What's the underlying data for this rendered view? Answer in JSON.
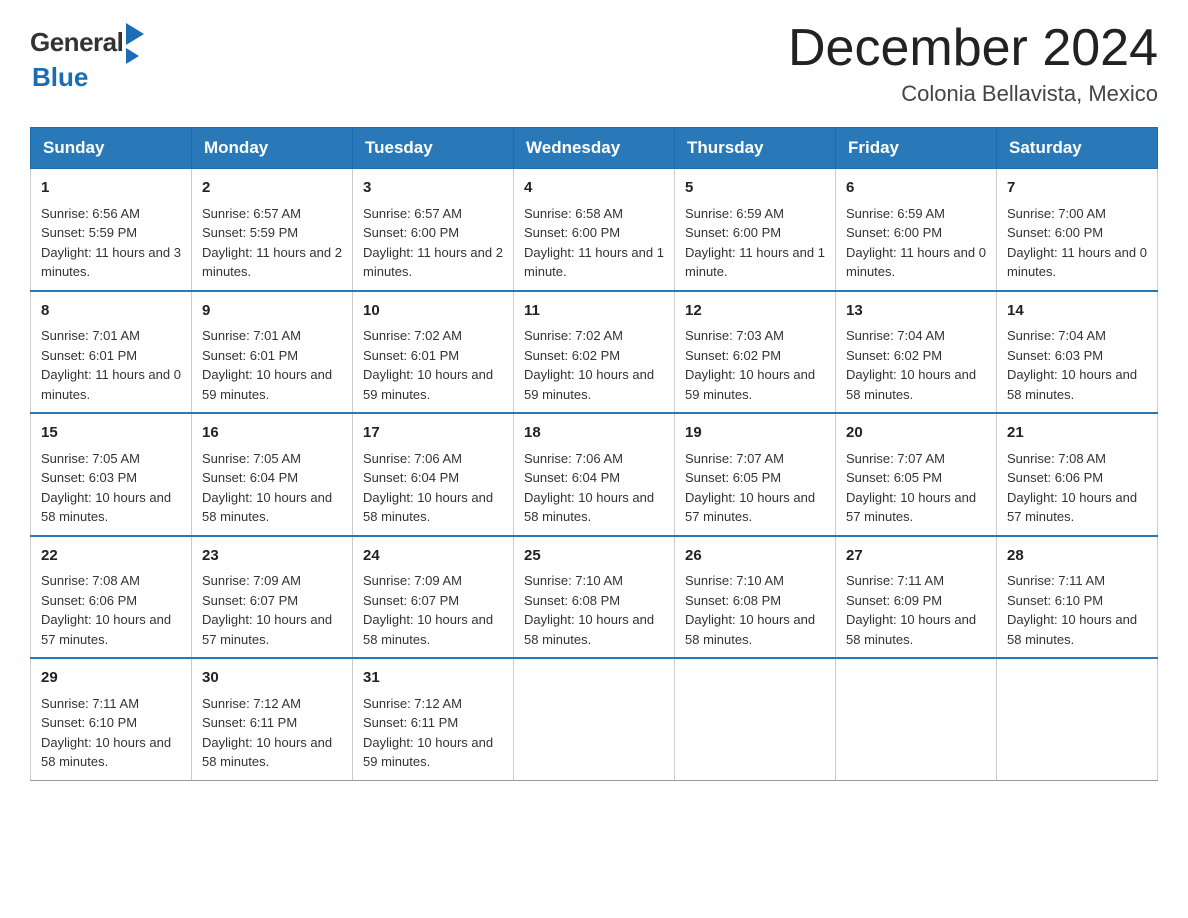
{
  "header": {
    "logo_general": "General",
    "logo_blue": "Blue",
    "month_title": "December 2024",
    "location": "Colonia Bellavista, Mexico"
  },
  "days_of_week": [
    "Sunday",
    "Monday",
    "Tuesday",
    "Wednesday",
    "Thursday",
    "Friday",
    "Saturday"
  ],
  "weeks": [
    [
      {
        "day": "1",
        "sunrise": "Sunrise: 6:56 AM",
        "sunset": "Sunset: 5:59 PM",
        "daylight": "Daylight: 11 hours and 3 minutes."
      },
      {
        "day": "2",
        "sunrise": "Sunrise: 6:57 AM",
        "sunset": "Sunset: 5:59 PM",
        "daylight": "Daylight: 11 hours and 2 minutes."
      },
      {
        "day": "3",
        "sunrise": "Sunrise: 6:57 AM",
        "sunset": "Sunset: 6:00 PM",
        "daylight": "Daylight: 11 hours and 2 minutes."
      },
      {
        "day": "4",
        "sunrise": "Sunrise: 6:58 AM",
        "sunset": "Sunset: 6:00 PM",
        "daylight": "Daylight: 11 hours and 1 minute."
      },
      {
        "day": "5",
        "sunrise": "Sunrise: 6:59 AM",
        "sunset": "Sunset: 6:00 PM",
        "daylight": "Daylight: 11 hours and 1 minute."
      },
      {
        "day": "6",
        "sunrise": "Sunrise: 6:59 AM",
        "sunset": "Sunset: 6:00 PM",
        "daylight": "Daylight: 11 hours and 0 minutes."
      },
      {
        "day": "7",
        "sunrise": "Sunrise: 7:00 AM",
        "sunset": "Sunset: 6:00 PM",
        "daylight": "Daylight: 11 hours and 0 minutes."
      }
    ],
    [
      {
        "day": "8",
        "sunrise": "Sunrise: 7:01 AM",
        "sunset": "Sunset: 6:01 PM",
        "daylight": "Daylight: 11 hours and 0 minutes."
      },
      {
        "day": "9",
        "sunrise": "Sunrise: 7:01 AM",
        "sunset": "Sunset: 6:01 PM",
        "daylight": "Daylight: 10 hours and 59 minutes."
      },
      {
        "day": "10",
        "sunrise": "Sunrise: 7:02 AM",
        "sunset": "Sunset: 6:01 PM",
        "daylight": "Daylight: 10 hours and 59 minutes."
      },
      {
        "day": "11",
        "sunrise": "Sunrise: 7:02 AM",
        "sunset": "Sunset: 6:02 PM",
        "daylight": "Daylight: 10 hours and 59 minutes."
      },
      {
        "day": "12",
        "sunrise": "Sunrise: 7:03 AM",
        "sunset": "Sunset: 6:02 PM",
        "daylight": "Daylight: 10 hours and 59 minutes."
      },
      {
        "day": "13",
        "sunrise": "Sunrise: 7:04 AM",
        "sunset": "Sunset: 6:02 PM",
        "daylight": "Daylight: 10 hours and 58 minutes."
      },
      {
        "day": "14",
        "sunrise": "Sunrise: 7:04 AM",
        "sunset": "Sunset: 6:03 PM",
        "daylight": "Daylight: 10 hours and 58 minutes."
      }
    ],
    [
      {
        "day": "15",
        "sunrise": "Sunrise: 7:05 AM",
        "sunset": "Sunset: 6:03 PM",
        "daylight": "Daylight: 10 hours and 58 minutes."
      },
      {
        "day": "16",
        "sunrise": "Sunrise: 7:05 AM",
        "sunset": "Sunset: 6:04 PM",
        "daylight": "Daylight: 10 hours and 58 minutes."
      },
      {
        "day": "17",
        "sunrise": "Sunrise: 7:06 AM",
        "sunset": "Sunset: 6:04 PM",
        "daylight": "Daylight: 10 hours and 58 minutes."
      },
      {
        "day": "18",
        "sunrise": "Sunrise: 7:06 AM",
        "sunset": "Sunset: 6:04 PM",
        "daylight": "Daylight: 10 hours and 58 minutes."
      },
      {
        "day": "19",
        "sunrise": "Sunrise: 7:07 AM",
        "sunset": "Sunset: 6:05 PM",
        "daylight": "Daylight: 10 hours and 57 minutes."
      },
      {
        "day": "20",
        "sunrise": "Sunrise: 7:07 AM",
        "sunset": "Sunset: 6:05 PM",
        "daylight": "Daylight: 10 hours and 57 minutes."
      },
      {
        "day": "21",
        "sunrise": "Sunrise: 7:08 AM",
        "sunset": "Sunset: 6:06 PM",
        "daylight": "Daylight: 10 hours and 57 minutes."
      }
    ],
    [
      {
        "day": "22",
        "sunrise": "Sunrise: 7:08 AM",
        "sunset": "Sunset: 6:06 PM",
        "daylight": "Daylight: 10 hours and 57 minutes."
      },
      {
        "day": "23",
        "sunrise": "Sunrise: 7:09 AM",
        "sunset": "Sunset: 6:07 PM",
        "daylight": "Daylight: 10 hours and 57 minutes."
      },
      {
        "day": "24",
        "sunrise": "Sunrise: 7:09 AM",
        "sunset": "Sunset: 6:07 PM",
        "daylight": "Daylight: 10 hours and 58 minutes."
      },
      {
        "day": "25",
        "sunrise": "Sunrise: 7:10 AM",
        "sunset": "Sunset: 6:08 PM",
        "daylight": "Daylight: 10 hours and 58 minutes."
      },
      {
        "day": "26",
        "sunrise": "Sunrise: 7:10 AM",
        "sunset": "Sunset: 6:08 PM",
        "daylight": "Daylight: 10 hours and 58 minutes."
      },
      {
        "day": "27",
        "sunrise": "Sunrise: 7:11 AM",
        "sunset": "Sunset: 6:09 PM",
        "daylight": "Daylight: 10 hours and 58 minutes."
      },
      {
        "day": "28",
        "sunrise": "Sunrise: 7:11 AM",
        "sunset": "Sunset: 6:10 PM",
        "daylight": "Daylight: 10 hours and 58 minutes."
      }
    ],
    [
      {
        "day": "29",
        "sunrise": "Sunrise: 7:11 AM",
        "sunset": "Sunset: 6:10 PM",
        "daylight": "Daylight: 10 hours and 58 minutes."
      },
      {
        "day": "30",
        "sunrise": "Sunrise: 7:12 AM",
        "sunset": "Sunset: 6:11 PM",
        "daylight": "Daylight: 10 hours and 58 minutes."
      },
      {
        "day": "31",
        "sunrise": "Sunrise: 7:12 AM",
        "sunset": "Sunset: 6:11 PM",
        "daylight": "Daylight: 10 hours and 59 minutes."
      },
      {
        "day": "",
        "sunrise": "",
        "sunset": "",
        "daylight": ""
      },
      {
        "day": "",
        "sunrise": "",
        "sunset": "",
        "daylight": ""
      },
      {
        "day": "",
        "sunrise": "",
        "sunset": "",
        "daylight": ""
      },
      {
        "day": "",
        "sunrise": "",
        "sunset": "",
        "daylight": ""
      }
    ]
  ]
}
